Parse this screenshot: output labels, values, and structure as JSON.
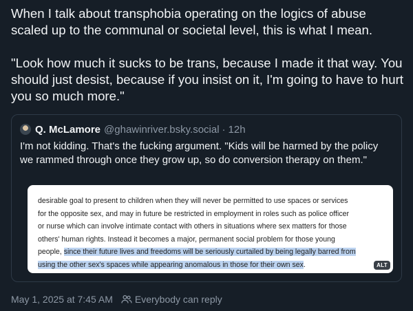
{
  "post": {
    "paragraphs": [
      "When I talk about transphobia operating on the logics of abuse scaled up to the communal or societal level, this is what I mean.",
      "\"Look how much it sucks to be trans, because I made it that way. You should just desist, because if you insist on it, I'm going to have to hurt you so much more.\""
    ],
    "timestamp": "May 1, 2025 at 7:45 AM",
    "reply_setting": "Everybody can reply"
  },
  "quote": {
    "author_name": "Q. McLamore",
    "author_handle": "@ghawinriver.bsky.social",
    "separator": "·",
    "time_ago": "12h",
    "text": "I'm not kidding. That's the fucking argument. \"Kids will be harmed by the policy we rammed through once they grow up, so do conversion therapy on them.\"",
    "image": {
      "lines": [
        "desirable goal to present to children when they will never be permitted to use spaces or services",
        "for the opposite sex, and may in future be restricted in employment in roles such as police officer",
        "or nurse which can involve intimate contact with others in situations where sex matters for those",
        "others' human rights. Instead it becomes a major, permanent social problem for those young"
      ],
      "line5_plain": "people, ",
      "line5_highlight": "since their future lives and freedoms will be seriously curtailed by being legally barred from",
      "line6_highlight": "using the other sex's spaces while appearing anomalous in those for their own sex",
      "line6_plain": ".",
      "alt_label": "ALT"
    }
  },
  "icons": {
    "avatar": "avatar",
    "reply_setting_icon": "people-icon"
  },
  "colors": {
    "background": "#161e27",
    "text": "#f1f3f5",
    "muted": "#8d98a5",
    "border": "#2e3a47",
    "highlight": "#bcd3f0"
  }
}
